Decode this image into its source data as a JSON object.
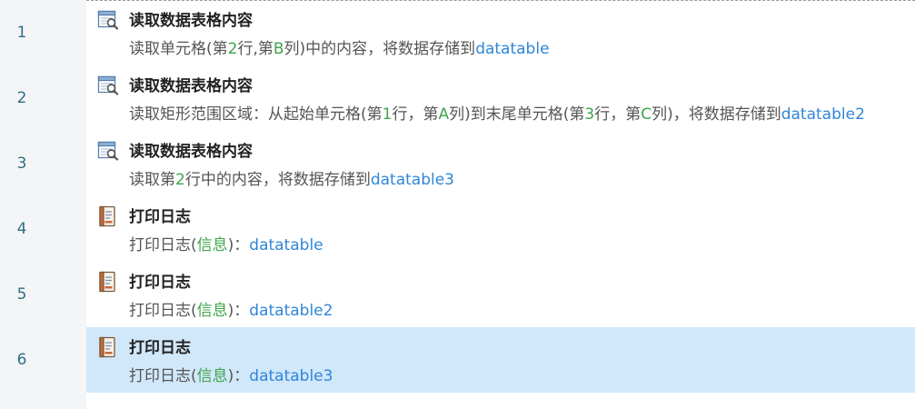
{
  "colors": {
    "selected_background": "#d1e7fa",
    "gutter_background": "#f4f5f7",
    "number_color": "#2f6f86",
    "param_green": "#3fa54a",
    "variable_blue": "#2f86d8",
    "description_gray": "#555555"
  },
  "steps": [
    {
      "number": "1",
      "icon": "read-table-icon",
      "title": "读取数据表格内容",
      "selected": false,
      "desc": [
        {
          "t": "读取单元格(第",
          "c": "plain"
        },
        {
          "t": "2",
          "c": "num"
        },
        {
          "t": "行,第",
          "c": "plain"
        },
        {
          "t": "B",
          "c": "num"
        },
        {
          "t": "列)中的内容，将数据存储到",
          "c": "plain"
        },
        {
          "t": "datatable",
          "c": "var"
        }
      ]
    },
    {
      "number": "2",
      "icon": "read-table-icon",
      "title": "读取数据表格内容",
      "selected": false,
      "desc": [
        {
          "t": "读取矩形范围区域：从起始单元格(第",
          "c": "plain"
        },
        {
          "t": "1",
          "c": "num"
        },
        {
          "t": "行，第",
          "c": "plain"
        },
        {
          "t": "A",
          "c": "num"
        },
        {
          "t": "列)到末尾单元格(第",
          "c": "plain"
        },
        {
          "t": "3",
          "c": "num"
        },
        {
          "t": "行，第",
          "c": "plain"
        },
        {
          "t": "C",
          "c": "num"
        },
        {
          "t": "列)，将数据存储到",
          "c": "plain"
        },
        {
          "t": "datatable2",
          "c": "var"
        }
      ]
    },
    {
      "number": "3",
      "icon": "read-table-icon",
      "title": "读取数据表格内容",
      "selected": false,
      "desc": [
        {
          "t": "读取第",
          "c": "plain"
        },
        {
          "t": "2",
          "c": "num"
        },
        {
          "t": "行中的内容，将数据存储到",
          "c": "plain"
        },
        {
          "t": "datatable3",
          "c": "var"
        }
      ]
    },
    {
      "number": "4",
      "icon": "log-book-icon",
      "title": "打印日志",
      "selected": false,
      "desc": [
        {
          "t": "打印日志(",
          "c": "plain"
        },
        {
          "t": "信息",
          "c": "num"
        },
        {
          "t": ")：",
          "c": "plain"
        },
        {
          "t": "datatable",
          "c": "var"
        }
      ]
    },
    {
      "number": "5",
      "icon": "log-book-icon",
      "title": "打印日志",
      "selected": false,
      "desc": [
        {
          "t": "打印日志(",
          "c": "plain"
        },
        {
          "t": "信息",
          "c": "num"
        },
        {
          "t": ")：",
          "c": "plain"
        },
        {
          "t": "datatable2",
          "c": "var"
        }
      ]
    },
    {
      "number": "6",
      "icon": "log-book-icon",
      "title": "打印日志",
      "selected": true,
      "desc": [
        {
          "t": "打印日志(",
          "c": "plain"
        },
        {
          "t": "信息",
          "c": "num"
        },
        {
          "t": ")：",
          "c": "plain"
        },
        {
          "t": "datatable3",
          "c": "var"
        }
      ]
    }
  ]
}
